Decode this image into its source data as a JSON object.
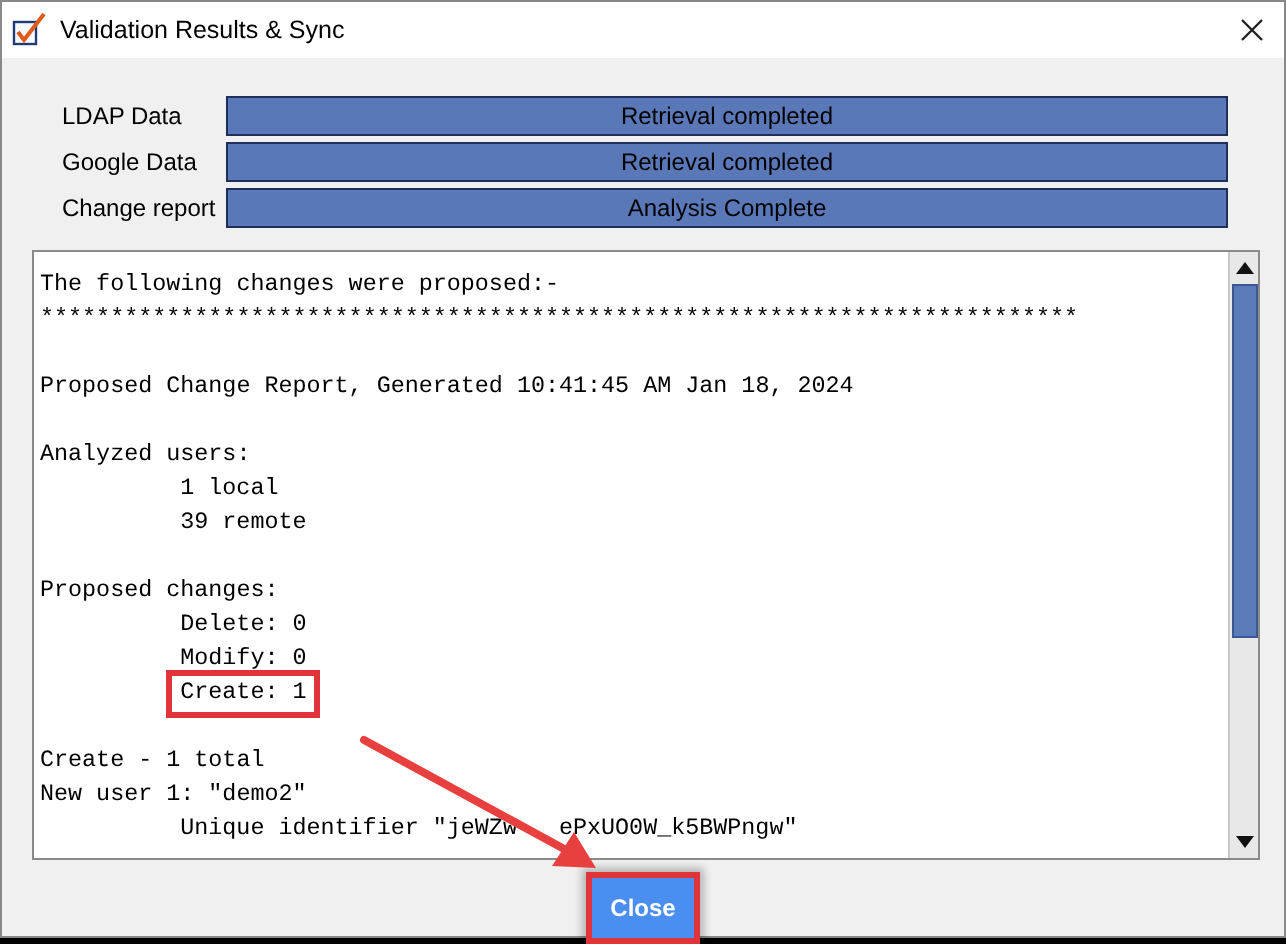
{
  "window": {
    "title": "Validation Results & Sync"
  },
  "status_rows": [
    {
      "label": "LDAP Data",
      "status": "Retrieval completed"
    },
    {
      "label": "Google Data",
      "status": "Retrieval completed"
    },
    {
      "label": "Change report",
      "status": "Analysis Complete"
    }
  ],
  "report": {
    "sections": [
      {
        "lines": [
          {
            "text": "The following changes were proposed:-",
            "indented": false,
            "highlighted": false
          },
          {
            "text": "**************************************************************************",
            "indented": false,
            "highlighted": false
          }
        ]
      },
      {
        "lines": [
          {
            "text": "Proposed Change Report, Generated 10:41:45 AM Jan 18, 2024",
            "indented": false,
            "highlighted": false
          }
        ]
      },
      {
        "lines": [
          {
            "text": "Analyzed users:",
            "indented": false,
            "highlighted": false
          },
          {
            "text": "1 local",
            "indented": true,
            "highlighted": false
          },
          {
            "text": "39 remote",
            "indented": true,
            "highlighted": false
          }
        ]
      },
      {
        "lines": [
          {
            "text": "Proposed changes:",
            "indented": false,
            "highlighted": false
          },
          {
            "text": "Delete: 0",
            "indented": true,
            "highlighted": false
          },
          {
            "text": "Modify: 0",
            "indented": true,
            "highlighted": false
          },
          {
            "text": "Create: 1",
            "indented": true,
            "highlighted": true
          }
        ]
      },
      {
        "lines": [
          {
            "text": "Create - 1 total",
            "indented": false,
            "highlighted": false
          },
          {
            "text": "New user 1: \"demo2\"",
            "indented": false,
            "highlighted": false
          },
          {
            "text": "Unique identifier \"jeWZw",
            "tail": "ePxUO0W_k5BWPngw\"",
            "indented": true,
            "highlighted": false
          }
        ]
      }
    ]
  },
  "close_button": {
    "label": "Close",
    "highlighted": true
  }
}
